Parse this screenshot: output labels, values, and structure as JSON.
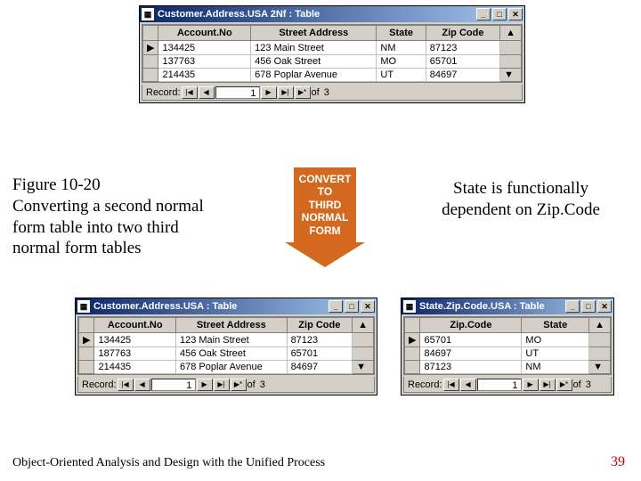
{
  "figure_caption": {
    "line1": "Figure 10-20",
    "line2": "Converting a second normal",
    "line3": "form table into two third",
    "line4": "normal form tables"
  },
  "arrow": {
    "l1": "CONVERT",
    "l2": "TO",
    "l3": "THIRD",
    "l4": "NORMAL",
    "l5": "FORM"
  },
  "note": {
    "line1": "State is functionally",
    "line2": "dependent on Zip.Code"
  },
  "footer": {
    "left": "Object-Oriented Analysis and Design with the Unified Process",
    "right": "39"
  },
  "windows": {
    "top": {
      "title": "Customer.Address.USA 2Nf : Table",
      "columns": [
        "Account.No",
        "Street Address",
        "State",
        "Zip Code"
      ],
      "rows": [
        [
          "134425",
          "123 Main Street",
          "NM",
          "87123"
        ],
        [
          "137763",
          "456 Oak Street",
          "MO",
          "65701"
        ],
        [
          "214435",
          "678 Poplar Avenue",
          "UT",
          "84697"
        ]
      ]
    },
    "bottomLeft": {
      "title": "Customer.Address.USA : Table",
      "columns": [
        "Account.No",
        "Street Address",
        "Zip Code"
      ],
      "rows": [
        [
          "134425",
          "123 Main Street",
          "87123"
        ],
        [
          "187763",
          "456 Oak Street",
          "65701"
        ],
        [
          "214435",
          "678 Poplar Avenue",
          "84697"
        ]
      ]
    },
    "bottomRight": {
      "title": "State.Zip.Code.USA : Table",
      "columns": [
        "Zip.Code",
        "State"
      ],
      "rows": [
        [
          "65701",
          "MO"
        ],
        [
          "84697",
          "UT"
        ],
        [
          "87123",
          "NM"
        ]
      ]
    }
  },
  "recordNav": {
    "label": "Record:",
    "current": "1",
    "total_prefix": "of",
    "total": "3"
  },
  "icons": {
    "grid": "▦",
    "first": "|◀",
    "prev": "◀",
    "next": "▶",
    "last": "▶|",
    "new": "▶*",
    "min": "_",
    "max": "□",
    "close": "✕",
    "row": "▶",
    "scrollUp": "▲",
    "scrollDown": "▼"
  }
}
